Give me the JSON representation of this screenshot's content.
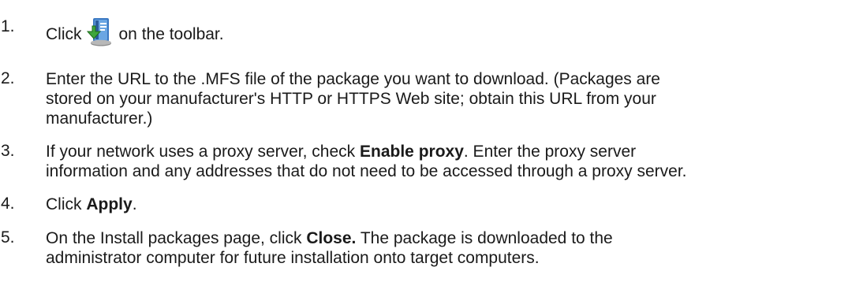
{
  "steps": [
    {
      "number": "1.",
      "before_icon": "Click",
      "icon": "download-package-icon",
      "after_icon": "on the toolbar."
    },
    {
      "number": "2.",
      "line1": "Enter the URL to the .MFS file of the package you want to download. (Packages are",
      "line2": "stored on your manufacturer's HTTP or HTTPS Web site; obtain this URL from your",
      "line3": "manufacturer.)"
    },
    {
      "number": "3.",
      "pre": "If your network uses a proxy server, check ",
      "bold": "Enable proxy",
      "post": ". Enter the proxy server",
      "line2": "information and any addresses that do not need to be accessed through a proxy server."
    },
    {
      "number": "4.",
      "pre": "Click ",
      "bold": "Apply",
      "post": "."
    },
    {
      "number": "5.",
      "pre": "On the Install packages page, click ",
      "bold": "Close.",
      "post": " The package is downloaded to the",
      "line2": "administrator computer for future installation onto target computers."
    }
  ]
}
